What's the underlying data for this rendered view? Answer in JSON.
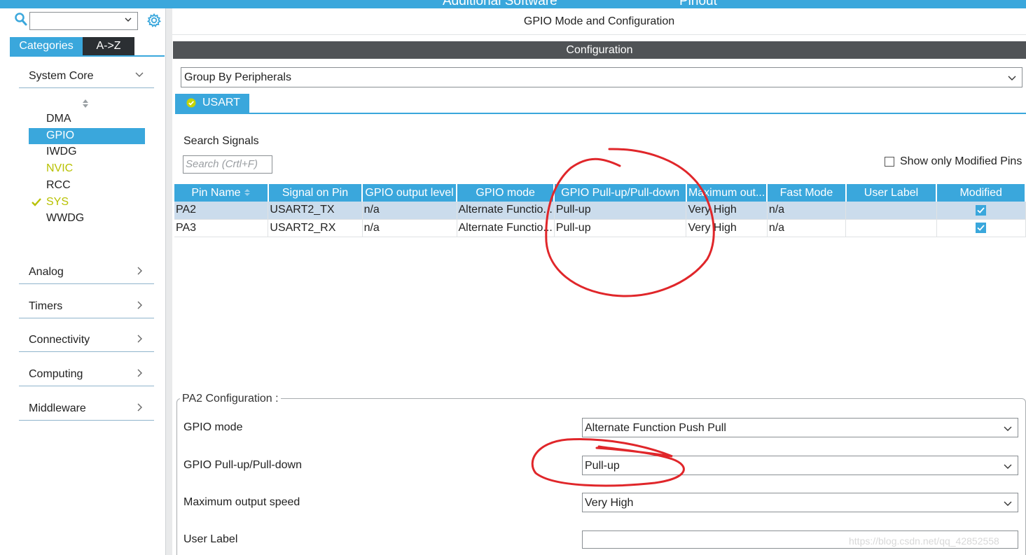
{
  "topbar": {
    "left_text": "Additional Software",
    "right_text": "Pinout"
  },
  "left_panel": {
    "tabs": [
      "Categories",
      "A->Z"
    ],
    "categories": [
      {
        "label": "System Core",
        "expanded": true
      },
      {
        "label": "Analog"
      },
      {
        "label": "Timers"
      },
      {
        "label": "Connectivity"
      },
      {
        "label": "Computing"
      },
      {
        "label": "Middleware"
      }
    ],
    "system_core_items": [
      {
        "label": "DMA"
      },
      {
        "label": "GPIO",
        "selected": true
      },
      {
        "label": "IWDG"
      },
      {
        "label": "NVIC",
        "highlight": "yellow"
      },
      {
        "label": "RCC"
      },
      {
        "label": "SYS",
        "highlight": "yellow",
        "checked": true
      },
      {
        "label": "WWDG"
      }
    ]
  },
  "main": {
    "title": "GPIO Mode and Configuration",
    "config_bar": "Configuration",
    "group_by": "Group By Peripherals",
    "peripheral_tab": "USART",
    "search_label": "Search Signals",
    "search_placeholder": "Search (Crtl+F)",
    "show_modified_label": "Show only Modified Pins",
    "table": {
      "headers": [
        "Pin Name",
        "Signal on Pin",
        "GPIO output level",
        "GPIO mode",
        "GPIO Pull-up/Pull-down",
        "Maximum out...",
        "Fast Mode",
        "User Label",
        "Modified"
      ],
      "rows": [
        [
          "PA2",
          "USART2_TX",
          "n/a",
          "Alternate Functio...",
          "Pull-up",
          "Very High",
          "n/a",
          "",
          true
        ],
        [
          "PA3",
          "USART2_RX",
          "n/a",
          "Alternate Functio...",
          "Pull-up",
          "Very High",
          "n/a",
          "",
          true
        ]
      ]
    },
    "pin_config": {
      "legend": "PA2 Configuration :",
      "gpio_mode_label": "GPIO mode",
      "gpio_mode_value": "Alternate Function Push Pull",
      "pull_label": "GPIO Pull-up/Pull-down",
      "pull_value": "Pull-up",
      "speed_label": "Maximum output speed",
      "speed_value": "Very High",
      "user_label_label": "User Label",
      "user_label_value": ""
    }
  },
  "watermark": "https://blog.csdn.net/qq_42852558",
  "colors": {
    "accent": "#3aa7dc",
    "dark": "#505356",
    "selected_row": "#cbdcec",
    "highlight_yellow": "#b8c100",
    "annotation": "#e0262a"
  }
}
